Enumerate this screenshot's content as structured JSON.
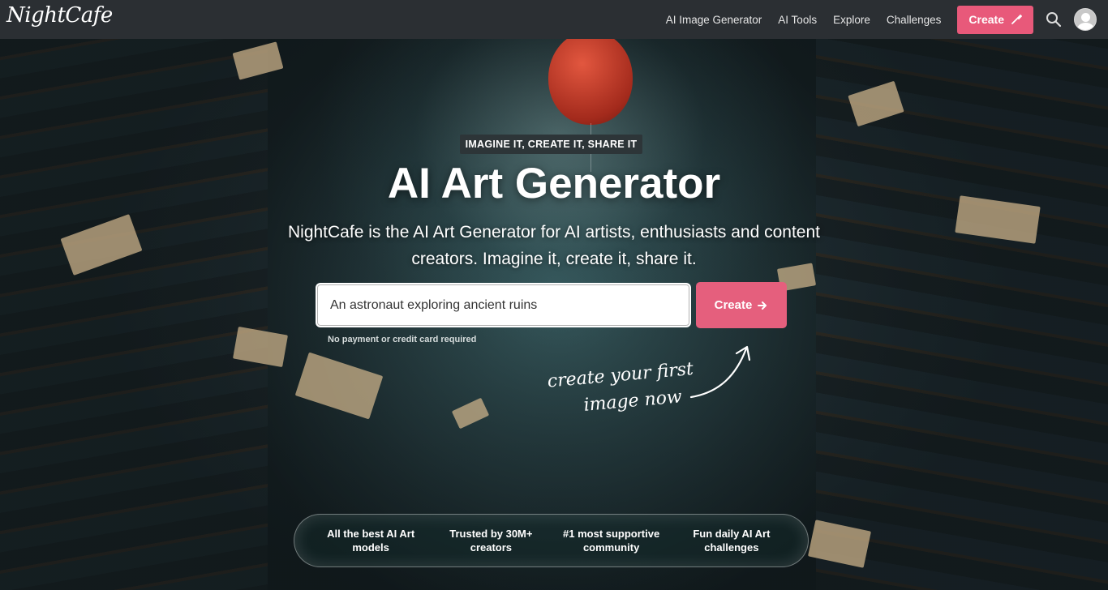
{
  "nav": {
    "logo": "NightCafe",
    "links": [
      "AI Image Generator",
      "AI Tools",
      "Explore",
      "Challenges"
    ],
    "create_label": "Create",
    "search_icon": "search-icon",
    "avatar_icon": "avatar-icon"
  },
  "hero": {
    "badge": "IMAGINE IT, CREATE IT, SHARE IT",
    "title": "AI Art Generator",
    "subtitle": "NightCafe is the AI Art Generator for AI artists, enthusiasts and content creators. Imagine it, create it, share it.",
    "prompt_value": "An astronaut exploring ancient ruins",
    "create_label": "Create",
    "note": "No payment or credit card required",
    "handwritten_line1": "create your first",
    "handwritten_line2": "image now"
  },
  "features": [
    "All the best AI Art models",
    "Trusted by 30M+ creators",
    "#1 most supportive community",
    "Fun daily AI Art challenges"
  ],
  "colors": {
    "accent": "#e8597a",
    "navbar": "#2b2f33"
  }
}
